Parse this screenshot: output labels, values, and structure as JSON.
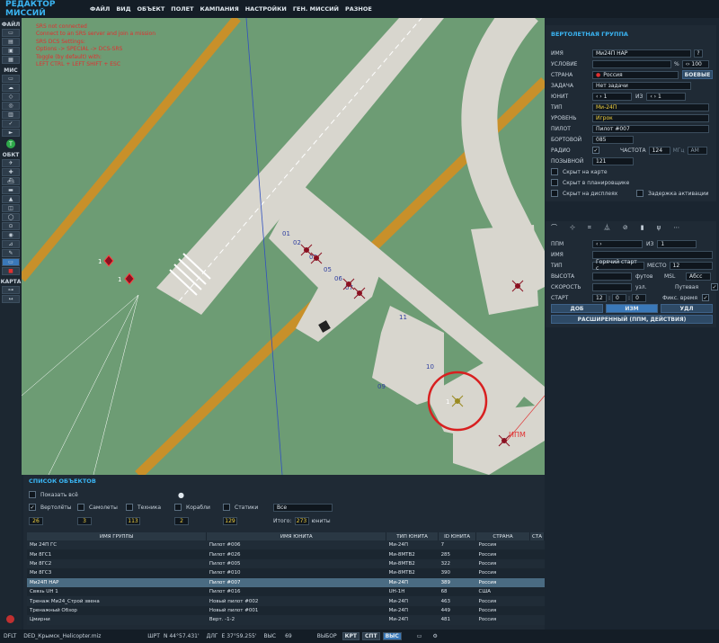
{
  "app_title": "РЕДАКТОР МИССИЙ",
  "menu": [
    "ФАЙЛ",
    "ВИД",
    "ОБЪЕКТ",
    "ПОЛЕТ",
    "КАМПАНИЯ",
    "НАСТРОЙКИ",
    "ГЕН. МИССИЙ",
    "РАЗНОЕ"
  ],
  "toolbar": {
    "file_label": "ФАЙЛ",
    "mis_label": "МИС",
    "obj_label": "ОБКТ",
    "map_label": "КАРТА",
    "round_icon": "Т"
  },
  "debug": [
    "SRS not connected",
    "Connect to an SRS server and join a mission",
    "SRS DCS Settings:",
    "Options -> SPECIAL -> DCS-SRS",
    "Toggle (by default) with:",
    "LEFT CTRL + LEFT SHIFT + ESC"
  ],
  "map": {
    "parking_labels": [
      "01",
      "02",
      "03",
      "05",
      "06",
      "07",
      "11",
      "10",
      "09"
    ],
    "unit_label": "1",
    "waypoint_label": "ИПМ"
  },
  "group_panel": {
    "title": "ВЕРТОЛЕТНАЯ ГРУППА",
    "name_label": "ИМЯ",
    "name_value": "Ми24П НАР",
    "name_help": "?",
    "condition_label": "УСЛОВИЕ",
    "condition_pct": "%",
    "condition_value": "100",
    "country_label": "СТРАНА",
    "country_value": "Россия",
    "combat_button": "БОЕВЫЕ",
    "task_label": "ЗАДАЧА",
    "task_value": "Нет задачи",
    "unit_label": "ЮНИТ",
    "unit_value": "1",
    "of_label": "ИЗ",
    "of_value": "1",
    "type_label": "ТИП",
    "type_value": "Ми-24П",
    "skill_label": "УРОВЕНЬ",
    "skill_value": "Игрок",
    "pilot_label": "ПИЛОТ",
    "pilot_value": "Пилот #007",
    "board_label": "БОРТОВОЙ",
    "board_value": "085",
    "radio_label": "РАДИО",
    "radio_check": "✓",
    "freq_label": "ЧАСТОТА",
    "freq_value": "124",
    "freq_unit": "МГц",
    "mod_value": "AM",
    "callsign_label": "ПОЗЫВНОЙ",
    "callsign_value": "121",
    "hidden_map": "Скрыт на карте",
    "hidden_planner": "Скрыт в планировщике",
    "hidden_display": "Скрыт на дисплеях",
    "delay_activation": "Задержка активации"
  },
  "waypoint_panel": {
    "tab_icons": [
      "route-icon",
      "target-icon",
      "trigger-icon",
      "payload-icon",
      "failures-icon",
      "fuel-icon",
      "radio-icon",
      "more-icon"
    ],
    "wp_label": "ППМ",
    "wp_of": "ИЗ",
    "wp_total": "1",
    "name_label": "ИМЯ",
    "type_label": "ТИП",
    "type_value": "Горячий старт с",
    "place_label": "МЕСТО",
    "place_value": "12",
    "alt_label": "ВЫСОТА",
    "alt_unit": "футов",
    "alt_ref": "MSL",
    "alt_mode": "Абсс",
    "speed_label": "СКОРОСТЬ",
    "speed_unit": "узл.",
    "speed_mode": "Путевая",
    "start_label": "СТАРТ",
    "start_h": "12",
    "start_m": "0",
    "start_s": "0",
    "fixed_time": "Фикс. время",
    "add_button": "ДОБ",
    "edit_button": "ИЗМ",
    "del_button": "УДЛ",
    "extended_button": "РАСШИРЕННЫЙ (ППМ, ДЕЙСТВИЯ)"
  },
  "objects": {
    "title": "СПИСОК ОБЪЕКТОВ",
    "show_all": "Показать всё",
    "categories": [
      {
        "label": "Вертолёты",
        "count": "26",
        "checked": true
      },
      {
        "label": "Самолеты",
        "count": "3",
        "checked": false
      },
      {
        "label": "Техника",
        "count": "113",
        "checked": false
      },
      {
        "label": "Корабли",
        "count": "2",
        "checked": false
      },
      {
        "label": "Статики",
        "count": "129",
        "checked": false
      }
    ],
    "coalition_value": "Все",
    "total_label": "Итого:",
    "total_value": "273",
    "total_unit": "юниты",
    "columns": [
      "ИМЯ ГРУППЫ",
      "ИМЯ ЮНИТА",
      "ТИП ЮНИТА",
      "ID ЮНИТА",
      "СТРАНА",
      "СТА"
    ],
    "rows": [
      [
        "Ми 24П ГС",
        "Пилот #006",
        "Ми-24П",
        "7",
        "Россия"
      ],
      [
        "Ми 8ГС1",
        "Пилот #026",
        "Ми-8МТВ2",
        "285",
        "Россия"
      ],
      [
        "Ми 8ГС2",
        "Пилот #005",
        "Ми-8МТВ2",
        "322",
        "Россия"
      ],
      [
        "Ми 8ГС3",
        "Пилот #010",
        "Ми-8МТВ2",
        "390",
        "Россия"
      ],
      [
        "Ми24П НАР",
        "Пилот #007",
        "Ми-24П",
        "389",
        "Россия"
      ],
      [
        "Связь UH 1",
        "Пилот #016",
        "UH-1H",
        "68",
        "США"
      ],
      [
        "Тренаж Ми24_Строй звена",
        "Новый пилот #002",
        "Ми-24П",
        "463",
        "Россия"
      ],
      [
        "Тренажный Обзор",
        "Новый пилот #001",
        "Ми-24П",
        "449",
        "Россия"
      ],
      [
        "Цмирни",
        "Верт. -1-2",
        "Ми-24П",
        "481",
        "Россия"
      ]
    ]
  },
  "status": {
    "layout": "DFLT",
    "file": "DED_Крымск_Helicopter.miz",
    "lat_label": "ШРТ",
    "lat_value": "N 44°57.431'",
    "lon_label": "ДЛГ",
    "lon_value": "E 37°59.255'",
    "alt_label": "ВЫС",
    "alt_value": "69",
    "select_label": "ВЫБОР",
    "btn_map": "КРТ",
    "btn_sat": "СПТ",
    "btn_alt": "ВЫС"
  }
}
